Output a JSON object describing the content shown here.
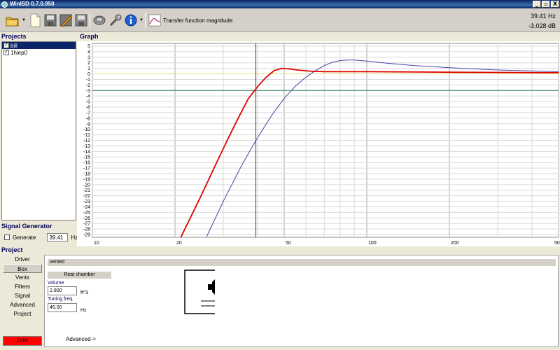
{
  "window": {
    "title": "WinISD 0.7.0.950",
    "buttons": [
      "_",
      "▫",
      "X"
    ]
  },
  "toolbar": {
    "icons": [
      "open-folder-icon",
      "new-document-icon",
      "save-icon",
      "edit-icon",
      "save-all-icon",
      "speaker-icon",
      "wrench-icon",
      "info-icon",
      "graph-icon"
    ],
    "graph_label": "Transfer function magnitude",
    "readout_freq": "39.41 Hz",
    "readout_db": "-3.028 dB"
  },
  "projects": {
    "header": "Projects",
    "items": [
      {
        "name": "bill",
        "checked": true,
        "selected": true
      },
      {
        "name": "1hiep0",
        "checked": true,
        "selected": false
      }
    ]
  },
  "signal_generator": {
    "header": "Signal Generator",
    "generate_label": "Generate",
    "frequency": "39.41",
    "unit": "Hz"
  },
  "graph": {
    "header": "Graph",
    "y_ticks": [
      "5",
      "4",
      "3",
      "2",
      "1",
      "0",
      "-1",
      "-2",
      "-3",
      "-4",
      "-5",
      "-6",
      "-7",
      "-8",
      "-9",
      "-10",
      "-11",
      "-12",
      "-13",
      "-14",
      "-15",
      "-16",
      "-17",
      "-18",
      "-19",
      "-20",
      "-21",
      "-22",
      "-23",
      "-24",
      "-25",
      "-26",
      "-27",
      "-28",
      "-29"
    ],
    "x_ticks": [
      "10",
      "20",
      "50",
      "100",
      "200",
      "500"
    ]
  },
  "chart_data": {
    "type": "line",
    "title": "",
    "xlabel": "",
    "ylabel": "",
    "x_scale": "log",
    "xlim": [
      10,
      500
    ],
    "ylim": [
      -29.5,
      5.5
    ],
    "grid": true,
    "cursor_x": 39.41,
    "reference_lines": [
      {
        "y": 0,
        "color": "#e8e800",
        "style": "dashed"
      },
      {
        "y": -3,
        "color": "#2e7d5a",
        "style": "solid"
      }
    ],
    "series": [
      {
        "color": "#dd0000",
        "x": [
          21,
          23,
          25,
          28,
          31,
          34,
          37,
          40,
          43,
          46,
          49,
          52,
          56,
          62,
          70,
          100,
          200,
          500
        ],
        "y": [
          -29.5,
          -25.5,
          -21.8,
          -16.6,
          -12.0,
          -8.0,
          -4.5,
          -2.3,
          -0.6,
          0.6,
          1.0,
          0.9,
          0.7,
          0.5,
          0.4,
          0.4,
          0.3,
          0.2
        ]
      },
      {
        "color": "#4444aa",
        "x": [
          26,
          30,
          35,
          40,
          45,
          50,
          55,
          60,
          65,
          70,
          75,
          80,
          85,
          90,
          100,
          120,
          150,
          200,
          300,
          500
        ],
        "y": [
          -29.5,
          -23.0,
          -16.5,
          -11.5,
          -7.5,
          -4.4,
          -2.2,
          -0.6,
          0.6,
          1.5,
          2.1,
          2.4,
          2.5,
          2.5,
          2.3,
          1.9,
          1.5,
          1.1,
          0.7,
          0.4
        ]
      }
    ]
  },
  "project": {
    "header": "Project",
    "nav": [
      "Driver",
      "Box",
      "Vents",
      "Filters",
      "Signal",
      "Advanced",
      "Project"
    ],
    "active_nav": "Box",
    "color_label": "Color",
    "box_type": "vented",
    "rear_chamber_label": "Rear chamber",
    "volume_label": "Volume",
    "volume_value": "2.800",
    "volume_unit": "ft^3",
    "tuning_label": "Tuning freq.",
    "tuning_value": "46.00",
    "tuning_unit": "Hz",
    "advanced_link": "Advanced->"
  }
}
